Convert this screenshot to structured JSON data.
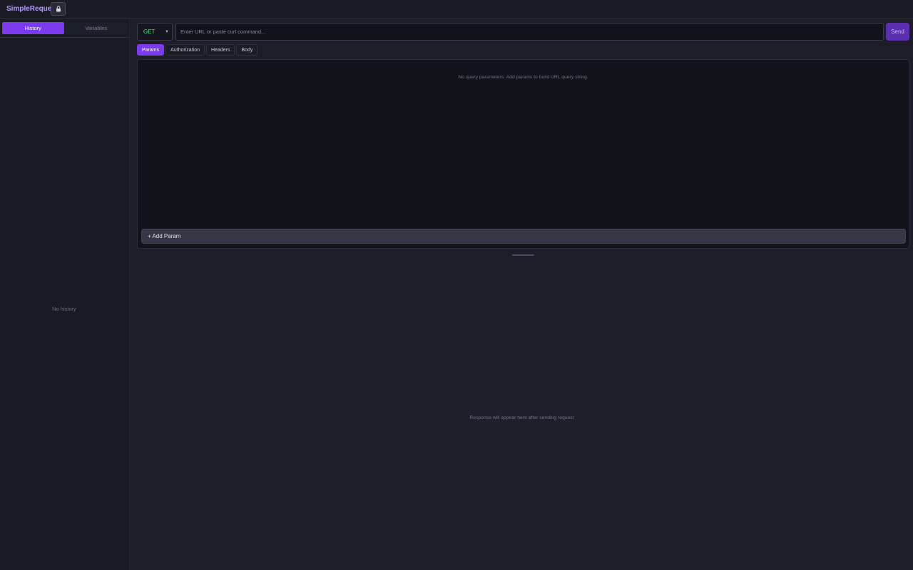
{
  "app": {
    "title": "SimpleRequest",
    "lock_icon": "lock-icon"
  },
  "sidebar": {
    "tabs": [
      {
        "label": "History",
        "active": true
      },
      {
        "label": "Variables",
        "active": false
      }
    ],
    "empty_text": "No history"
  },
  "request": {
    "method": "GET",
    "url_placeholder": "Enter URL or paste curl command...",
    "url_value": "",
    "send_label": "Send",
    "tabs": [
      {
        "label": "Params",
        "active": true
      },
      {
        "label": "Authorization",
        "active": false
      },
      {
        "label": "Headers",
        "active": false
      },
      {
        "label": "Body",
        "active": false
      }
    ],
    "params_empty_text": "No query parameters. Add params to build URL query string.",
    "add_param_label": "+ Add Param"
  },
  "response": {
    "empty_text": "Response will appear here after sending request"
  },
  "colors": {
    "accent": "#7c3aed",
    "method_get": "#4ade80",
    "brand_title": "#b49cff"
  }
}
